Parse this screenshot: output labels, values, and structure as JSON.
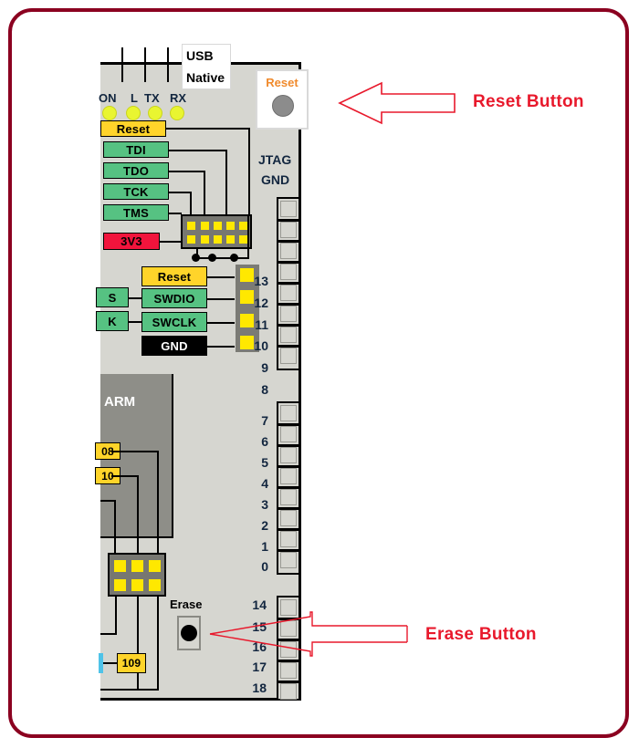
{
  "diagram": {
    "title": "Arduino Due board pinout - Reset and Erase buttons",
    "accent_color": "#e8192c",
    "frame_color": "#8b0020",
    "board_color": "#d6d6d0"
  },
  "board": {
    "usb_native": {
      "line1": "USB",
      "line2": "Native"
    },
    "reset_module": {
      "label": "Reset"
    },
    "leds": [
      {
        "name": "ON",
        "color": "#e9f531"
      },
      {
        "name": "L",
        "color": "#e9f531"
      },
      {
        "name": "TX",
        "color": "#e9f531"
      },
      {
        "name": "RX",
        "color": "#e9f531"
      }
    ],
    "jtag_labels": [
      {
        "text": "Reset",
        "style": "yellow"
      },
      {
        "text": "TDI",
        "style": "green"
      },
      {
        "text": "TDO",
        "style": "green"
      },
      {
        "text": "TCK",
        "style": "green"
      },
      {
        "text": "TMS",
        "style": "green"
      },
      {
        "text": "3V3",
        "style": "red"
      }
    ],
    "swd_labels": [
      {
        "text": "Reset",
        "style": "yellow"
      },
      {
        "text": "SWDIO",
        "style": "green"
      },
      {
        "text": "SWCLK",
        "style": "green"
      },
      {
        "text": "GND",
        "style": "black"
      }
    ],
    "swd_left_stubs": [
      {
        "text": "S",
        "style": "green"
      },
      {
        "text": "K",
        "style": "green"
      }
    ],
    "chip": {
      "label": "ARM"
    },
    "chip_pin_labels": [
      {
        "text": "08"
      },
      {
        "text": "10"
      }
    ],
    "bottom_pin_label": {
      "text": "109"
    },
    "texts": {
      "jtag": "JTAG",
      "gnd": "GND",
      "erase": "Erase"
    },
    "pin_numbers_upper": [
      "13",
      "12",
      "11",
      "10",
      "9",
      "8"
    ],
    "pin_numbers_lower": [
      "7",
      "6",
      "5",
      "4",
      "3",
      "2",
      "1",
      "0"
    ],
    "pin_numbers_bottom": [
      "14",
      "15",
      "16",
      "17",
      "18"
    ]
  },
  "annotations": [
    {
      "id": "reset",
      "label": "Reset Button",
      "arrow": "left-block-arrow"
    },
    {
      "id": "erase",
      "label": "Erase Button",
      "arrow": "left-thin-arrow"
    }
  ]
}
